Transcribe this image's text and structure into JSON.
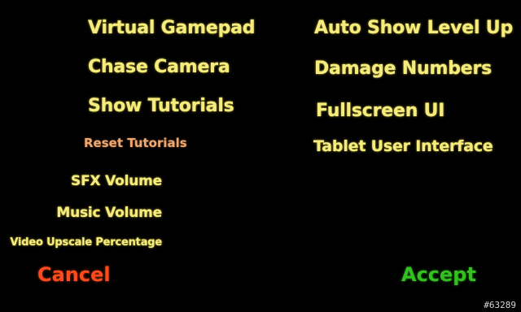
{
  "left_column": {
    "virtual_gamepad": "Virtual Gamepad",
    "chase_camera": "Chase Camera",
    "show_tutorials": "Show Tutorials",
    "reset_tutorials": "Reset Tutorials",
    "sfx_volume": "SFX Volume",
    "music_volume": "Music Volume",
    "video_upscale": "Video Upscale Percentage"
  },
  "right_column": {
    "auto_show_level_up": "Auto Show Level Up",
    "damage_numbers": "Damage Numbers",
    "fullscreen_ui": "Fullscreen UI",
    "tablet_ui": "Tablet User Interface"
  },
  "buttons": {
    "cancel": "Cancel",
    "accept": "Accept"
  },
  "watermark": "#63289",
  "colors": {
    "option_text": "#f6ec7e",
    "reset_link": "#f0a870",
    "cancel": "#ff4a1e",
    "accept": "#33c020",
    "background": "#000000"
  }
}
